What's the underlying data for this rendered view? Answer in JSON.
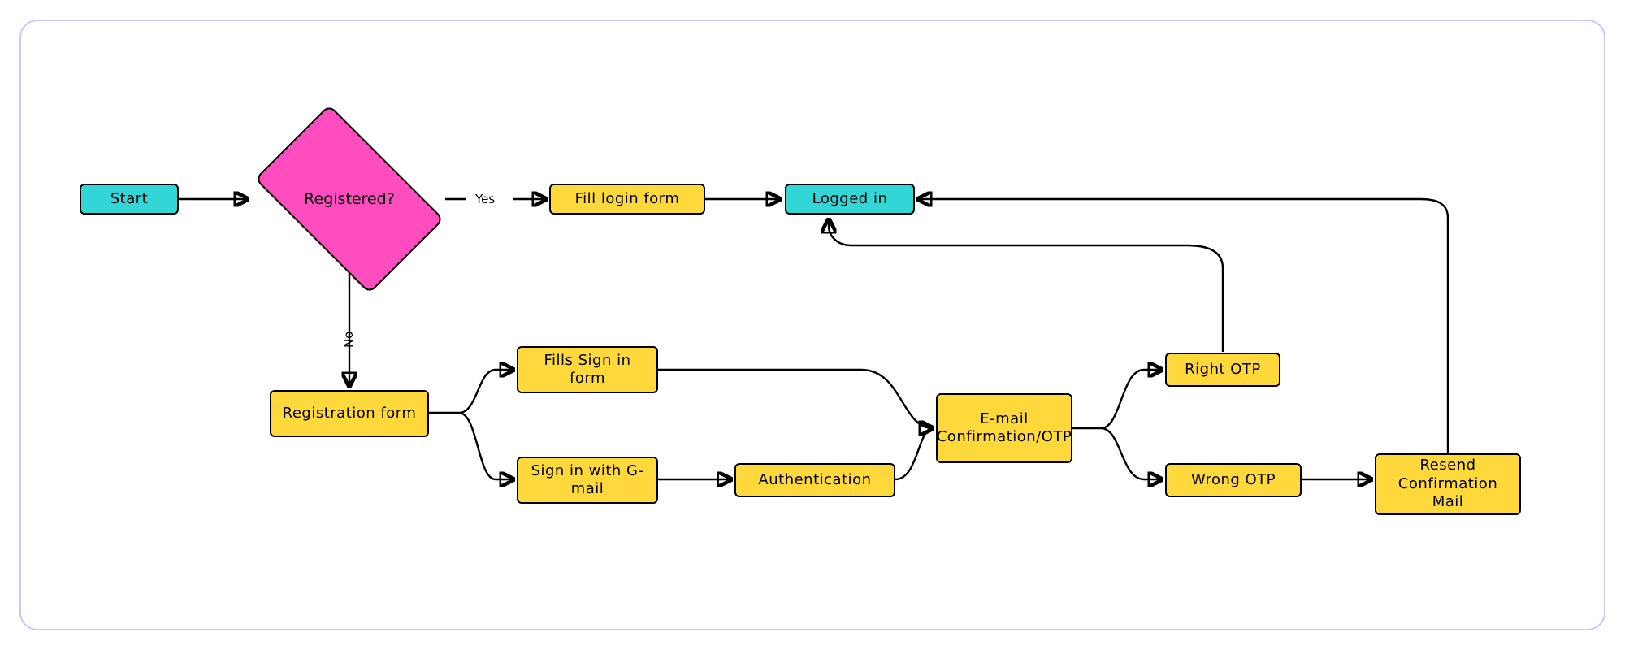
{
  "nodes": {
    "start": "Start",
    "registered": "Registered?",
    "fill_login_form": "Fill login form",
    "logged_in": "Logged in",
    "registration_form": "Registration form",
    "fills_signin_form": "Fills Sign in form",
    "signin_with_gmail": "Sign in with G-mail",
    "authentication": "Authentication",
    "email_confirmation_otp": "E-mail Confirmation/OTP",
    "right_otp": "Right OTP",
    "wrong_otp": "Wrong OTP",
    "resend_confirmation_mail": "Resend Confirmation Mail"
  },
  "edge_labels": {
    "yes": "Yes",
    "no": "No"
  },
  "colors": {
    "border_frame": "#c9c7ff",
    "cyan": "#32d6d6",
    "yellow": "#ffd93b",
    "pink": "#ff4dbf"
  }
}
